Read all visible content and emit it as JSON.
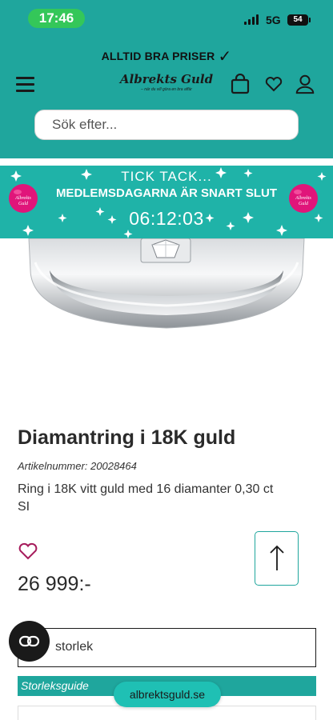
{
  "status_bar": {
    "time": "17:46",
    "network": "5G",
    "battery": "54"
  },
  "header": {
    "promo": "ALLTID BRA PRISER",
    "logo_text": "Albrekts Guld",
    "logo_tagline": "– när du vill göra en bra affär",
    "search_placeholder": "Sök efter..."
  },
  "banner": {
    "line1": "TICK TACK...",
    "line2": "MEDLEMSDAGARNA ÄR SNART SLUT",
    "timer": "06:12:03",
    "balloon_text": "Albrekts Guld"
  },
  "product": {
    "title": "Diamantring i 18K guld",
    "article_number": "Artikelnummer: 20028464",
    "description": "Ring i 18K vitt guld med 16 diamanter 0,30 ct SI",
    "price": "26 999:-",
    "size_select": "storlek",
    "size_guide": "Storleksguide"
  },
  "browser": {
    "url": "albrektsguld.se"
  },
  "colors": {
    "brand_teal": "#1fa69d",
    "banner_teal": "#1fb3a8",
    "balloon_pink": "#e0157a",
    "status_green": "#34c759"
  },
  "icons": [
    "menu-icon",
    "cart-bag-icon",
    "heart-icon",
    "user-icon",
    "check-icon",
    "arrow-up-icon",
    "chat-icon",
    "balloon-icon"
  ]
}
